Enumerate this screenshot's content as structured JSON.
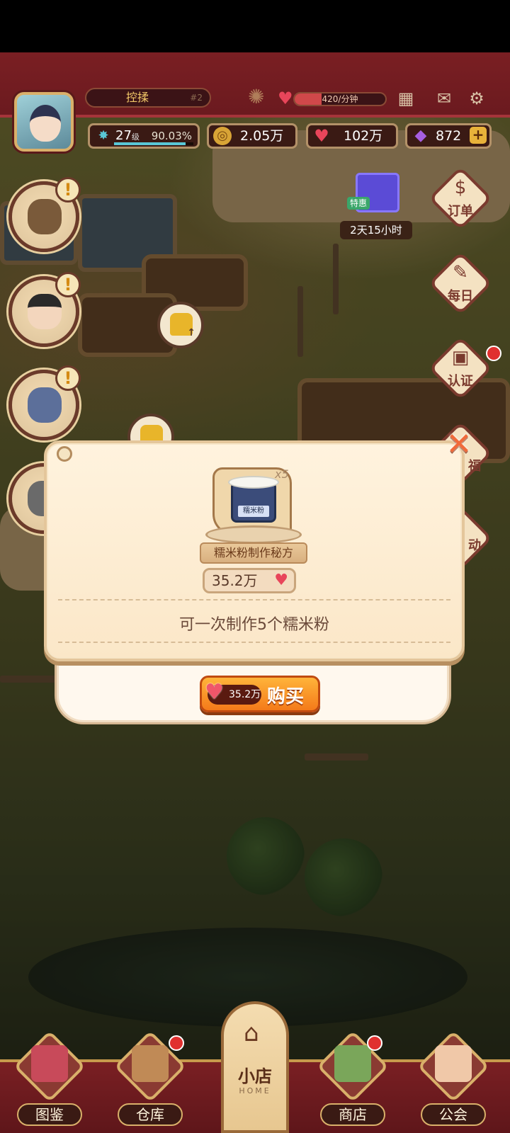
{
  "hud": {
    "player_name": "控揉",
    "rank": "#2",
    "rate": "420/分钟",
    "level": "27",
    "level_unit": "级",
    "level_progress": "90.03%",
    "coins": "2.05万",
    "hearts": "102万",
    "gems": "872",
    "plus": "+"
  },
  "promo": {
    "tag": "特惠",
    "timer": "2天15小时"
  },
  "right_menu": {
    "order": "订单",
    "daily": "每日",
    "verify": "认证",
    "fortune": "福",
    "event": "动"
  },
  "popup": {
    "item_label": "糯米粉",
    "multiplier": "x5",
    "title": "糯米粉制作秘方",
    "price": "35.2万",
    "description": "可一次制作5个糯米粉",
    "buy_price": "35.2万",
    "buy_label": "购买"
  },
  "bottom_nav": {
    "items": [
      {
        "label": "图鉴"
      },
      {
        "label": "仓库"
      },
      {
        "label": "小店",
        "sub": "HOME"
      },
      {
        "label": "商店"
      },
      {
        "label": "公会"
      }
    ]
  },
  "colors": {
    "hud_bg": "#7a1f23",
    "accent_gold": "#d9b06a",
    "heart_red": "#e8455a",
    "buy_orange": "#f47a1a"
  }
}
